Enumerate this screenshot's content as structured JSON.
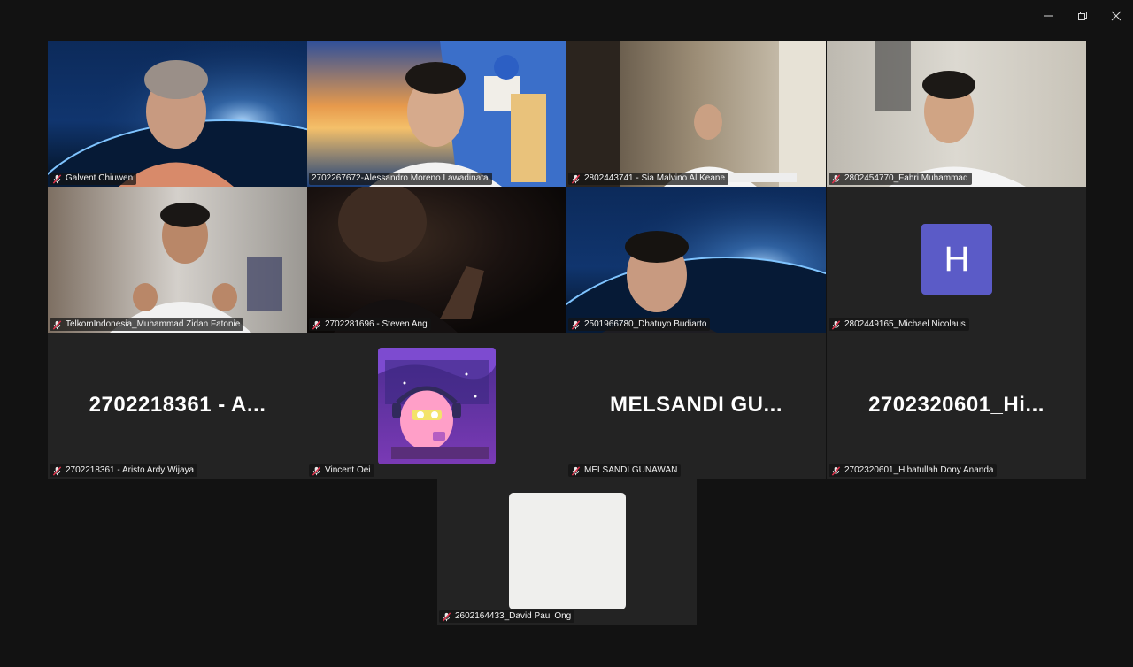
{
  "window_controls": {
    "minimize_icon": "minimize-icon",
    "restore_icon": "restore-icon",
    "close_icon": "close-icon"
  },
  "participants": [
    {
      "name": "Galvent Chiuwen",
      "muted": true,
      "video": "space-background"
    },
    {
      "name": "2702267672-Alessandro Moreno Lawadinata",
      "muted": false,
      "active_speaker": true,
      "video": "santorini-background"
    },
    {
      "name": "2802443741 - Sia Malvino Al Keane",
      "muted": true,
      "video": "room"
    },
    {
      "name": "2802454770_Fahri Muhammad",
      "muted": true,
      "video": "room"
    },
    {
      "name": "TelkomIndonesia_Muhammad Zidan Fatonie",
      "muted": true,
      "video": "room"
    },
    {
      "name": "2702281696 - Steven Ang",
      "muted": true,
      "video": "dark-room"
    },
    {
      "name": "2501966780_Dhatuyo Budiarto",
      "muted": true,
      "video": "space-background"
    },
    {
      "name": "2802449165_Michael Nicolaus",
      "muted": true,
      "avatar_letter": "H"
    },
    {
      "name": "2702218361 - Aristo Ardy Wijaya",
      "muted": true,
      "display_text": "2702218361 - A..."
    },
    {
      "name": "Vincent Oei",
      "muted": true,
      "profile_picture": "cartoon-character-with-headphones"
    },
    {
      "name": "MELSANDI GUNAWAN",
      "muted": true,
      "display_text": "MELSANDI GU..."
    },
    {
      "name": "2702320601_Hibatullah Dony Ananda",
      "muted": true,
      "display_text": "2702320601_Hi..."
    },
    {
      "name": "2602164433_David Paul Ong",
      "muted": true,
      "profile_picture": "blank"
    }
  ],
  "colors": {
    "background": "#121212",
    "tile": "#232323",
    "active_border": "#2ad47a",
    "avatar_bg": "#5b5bc7",
    "mute_red": "#e0324b"
  }
}
